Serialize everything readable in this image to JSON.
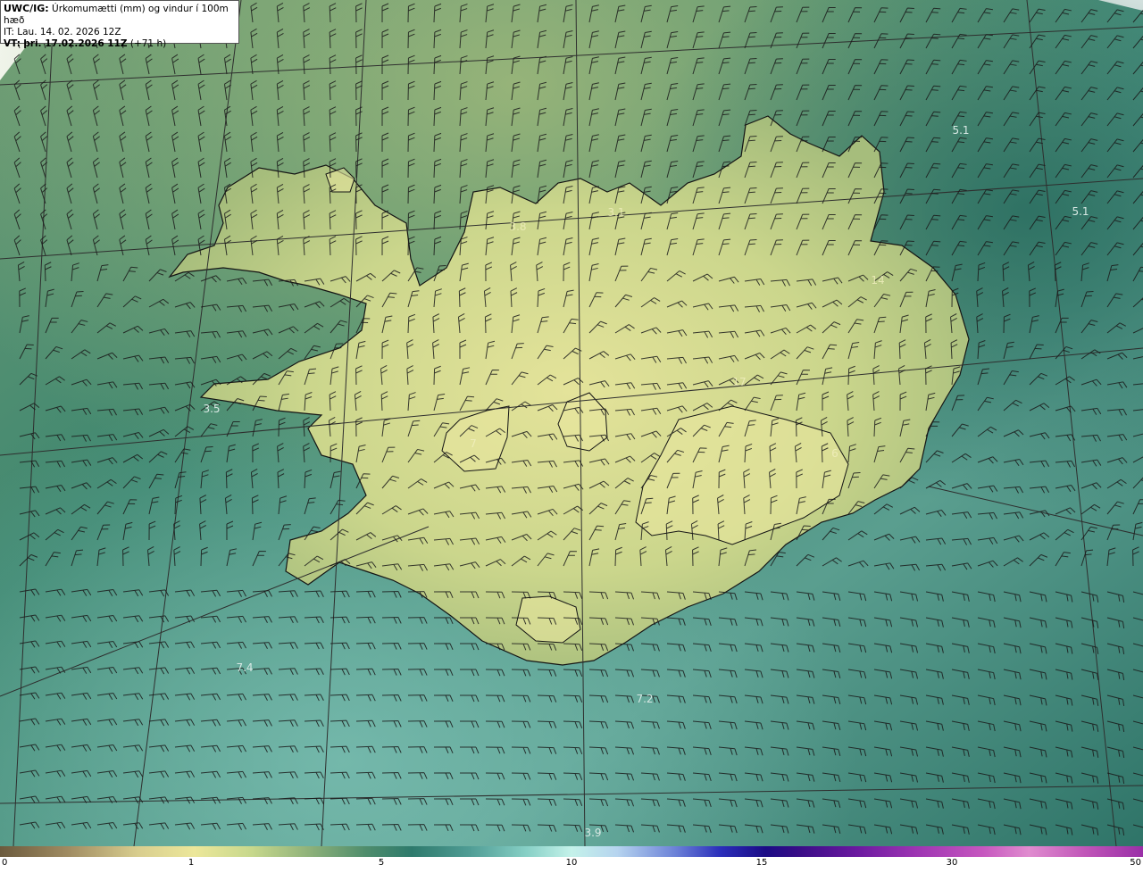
{
  "header": {
    "model": "UWC/IG:",
    "title": "Úrkomumætti (mm) og vindur í 100m hæð",
    "init_label": "IT:",
    "init_time": "Lau. 14. 02. 2026 12Z",
    "valid_label": "VT:",
    "valid_time": "þri. 17.02.2026 11Z",
    "lead": "(+71 h)"
  },
  "value_labels": [
    {
      "text": "5.1",
      "land": false
    },
    {
      "text": "5.1",
      "land": false
    },
    {
      "text": "3.8",
      "land": true
    },
    {
      "text": "3.1",
      "land": true
    },
    {
      "text": "14",
      "land": true
    },
    {
      "text": "17",
      "land": true
    },
    {
      "text": "3.5",
      "land": false
    },
    {
      "text": "7",
      "land": true
    },
    {
      "text": "6",
      "land": true
    },
    {
      "text": "7.4",
      "land": false
    },
    {
      "text": "7.2",
      "land": false
    },
    {
      "text": "3.9",
      "land": false
    }
  ],
  "colorbar": {
    "ticks": [
      "0",
      "1",
      "5",
      "10",
      "15",
      "30",
      "50"
    ]
  },
  "colors": {
    "sea_dark": "#2f7468",
    "sea_light": "#6fb0a6",
    "land_high": "#e6e59a",
    "land_low": "#a7bd7c",
    "coast": "#141414",
    "barb": "#1a1a1a",
    "graticule": "#2e2e2e"
  },
  "icons": {
    "wind_barb": "wind-barb-icon"
  }
}
